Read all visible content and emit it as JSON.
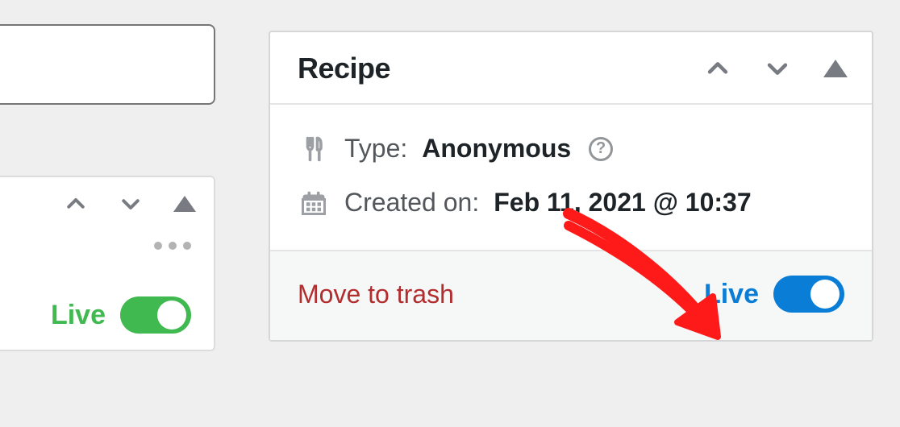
{
  "left_panel": {
    "live_label": "Live",
    "live_on": true
  },
  "recipe_panel": {
    "title": "Recipe",
    "type_label": "Type:",
    "type_value": "Anonymous",
    "created_label": "Created on:",
    "created_value": "Feb 11, 2021 @ 10:37",
    "trash_label": "Move to trash",
    "live_label": "Live",
    "live_on": true
  }
}
